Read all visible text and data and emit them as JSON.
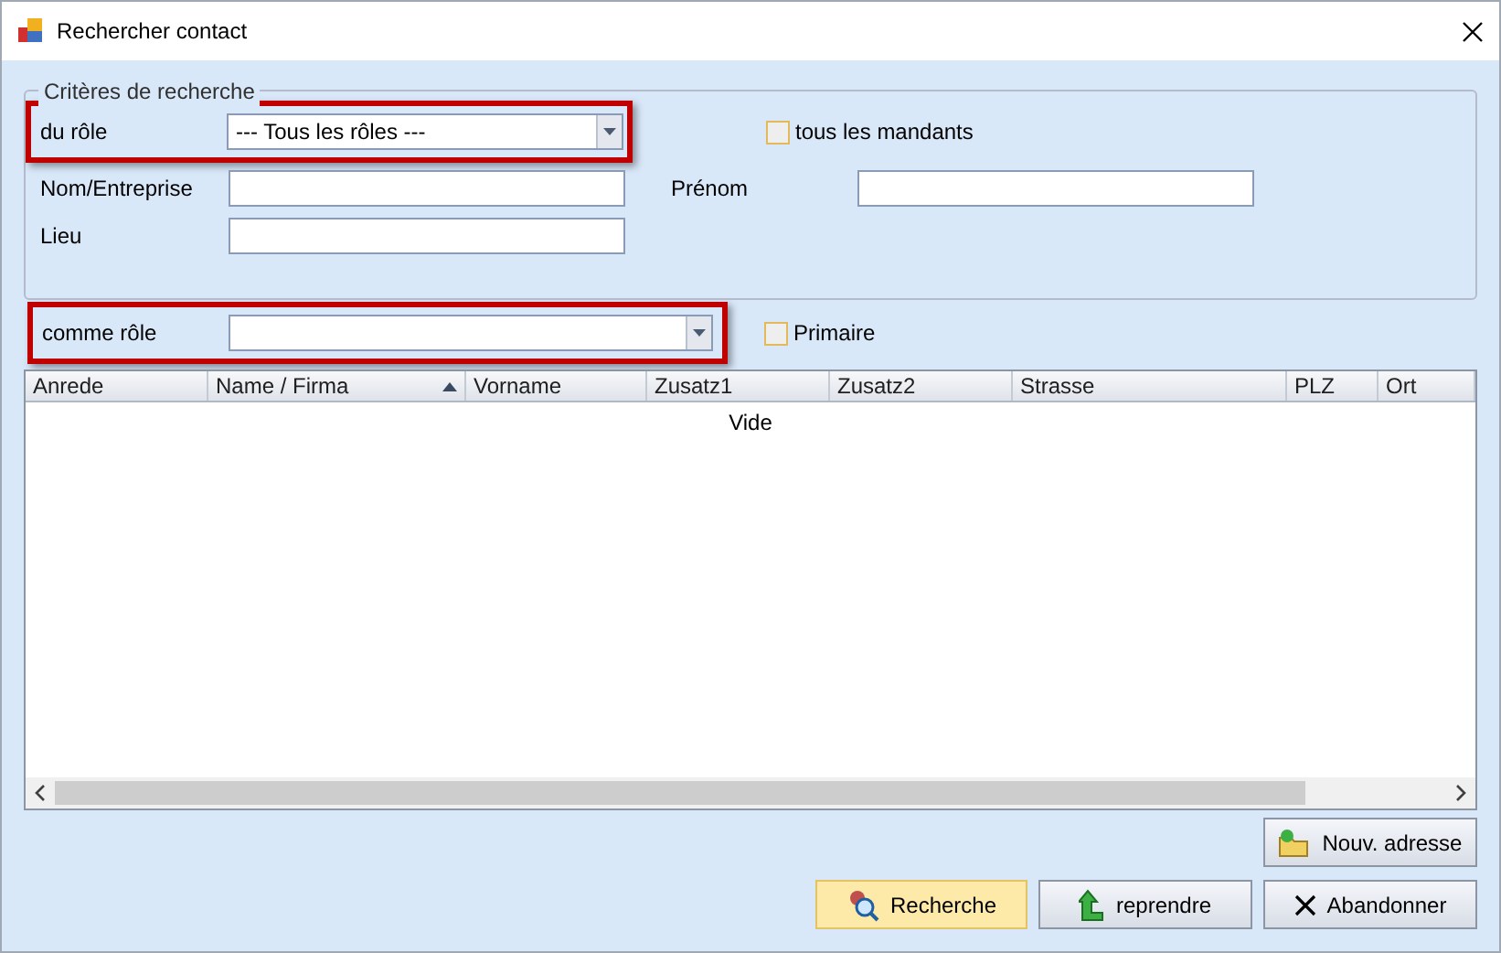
{
  "window": {
    "title": "Rechercher contact"
  },
  "criteria": {
    "legend": "Critères de recherche",
    "role": {
      "label": "du rôle",
      "value": "--- Tous les rôles ---",
      "highlighted": true
    },
    "all_clients": {
      "label": "tous les mandants",
      "checked": false
    },
    "name": {
      "label": "Nom/Entreprise"
    },
    "first_name": {
      "label": "Prénom"
    },
    "place": {
      "label": "Lieu"
    }
  },
  "as_role": {
    "label": "comme rôle",
    "highlighted": true
  },
  "primary": {
    "label": "Primaire",
    "checked": false
  },
  "table": {
    "columns": [
      {
        "label": "Anrede",
        "sorted": false
      },
      {
        "label": "Name / Firma",
        "sorted": true
      },
      {
        "label": "Vorname",
        "sorted": false
      },
      {
        "label": "Zusatz1",
        "sorted": false
      },
      {
        "label": "Zusatz2",
        "sorted": false
      },
      {
        "label": "Strasse",
        "sorted": false
      },
      {
        "label": "PLZ",
        "sorted": false
      },
      {
        "label": "Ort",
        "sorted": false
      }
    ],
    "empty_text": "Vide"
  },
  "buttons": [
    {
      "label": "Nouv. adresse",
      "kind": "new",
      "selected": false
    },
    {
      "label": "Recherche",
      "kind": "search",
      "selected": true
    },
    {
      "label": "reprendre",
      "kind": "take",
      "selected": false
    },
    {
      "label": "Abandonner",
      "kind": "cancel",
      "selected": false
    }
  ]
}
